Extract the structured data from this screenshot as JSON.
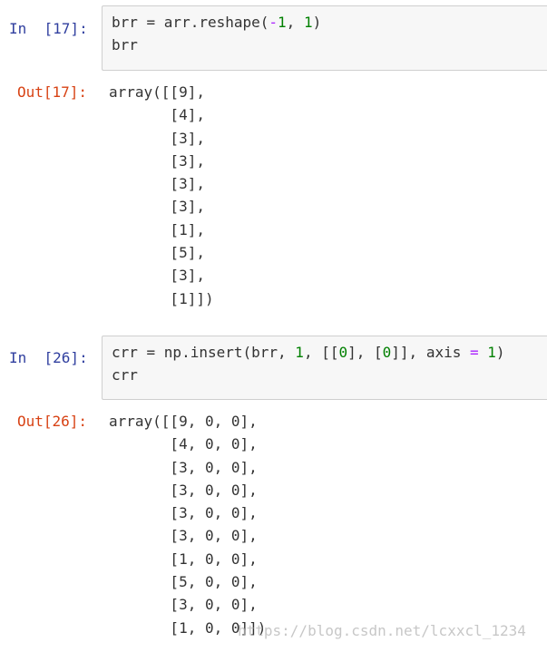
{
  "cells": [
    {
      "in_prompt": "In  [17]:",
      "code": [
        [
          {
            "t": "brr = arr.reshape(",
            "c": ""
          },
          {
            "t": "-",
            "c": "op"
          },
          {
            "t": "1",
            "c": "num"
          },
          {
            "t": ", ",
            "c": ""
          },
          {
            "t": "1",
            "c": "num"
          },
          {
            "t": ")",
            "c": ""
          }
        ],
        [
          {
            "t": "brr",
            "c": ""
          }
        ]
      ],
      "out_prompt": "Out[17]:",
      "output": [
        "array([[9],",
        "       [4],",
        "       [3],",
        "       [3],",
        "       [3],",
        "       [3],",
        "       [1],",
        "       [5],",
        "       [3],",
        "       [1]])"
      ]
    },
    {
      "in_prompt": "In  [26]:",
      "code": [
        [
          {
            "t": "crr = np.insert(brr, ",
            "c": ""
          },
          {
            "t": "1",
            "c": "num"
          },
          {
            "t": ", [[",
            "c": ""
          },
          {
            "t": "0",
            "c": "num"
          },
          {
            "t": "], [",
            "c": ""
          },
          {
            "t": "0",
            "c": "num"
          },
          {
            "t": "]], axis ",
            "c": ""
          },
          {
            "t": "=",
            "c": "op"
          },
          {
            "t": " ",
            "c": ""
          },
          {
            "t": "1",
            "c": "num"
          },
          {
            "t": ")",
            "c": ""
          }
        ],
        [
          {
            "t": "crr",
            "c": ""
          }
        ]
      ],
      "out_prompt": "Out[26]:",
      "output": [
        "array([[9, 0, 0],",
        "       [4, 0, 0],",
        "       [3, 0, 0],",
        "       [3, 0, 0],",
        "       [3, 0, 0],",
        "       [3, 0, 0],",
        "       [1, 0, 0],",
        "       [5, 0, 0],",
        "       [3, 0, 0],",
        "       [1, 0, 0]])"
      ]
    }
  ],
  "watermark": "https://blog.csdn.net/lcxxcl_1234",
  "colors": {
    "in_prompt": "#303f9f",
    "out_prompt": "#d84315",
    "number": "#008000",
    "operator": "#aa22ff",
    "input_bg": "#f7f7f7",
    "input_border": "#cfcfcf"
  }
}
